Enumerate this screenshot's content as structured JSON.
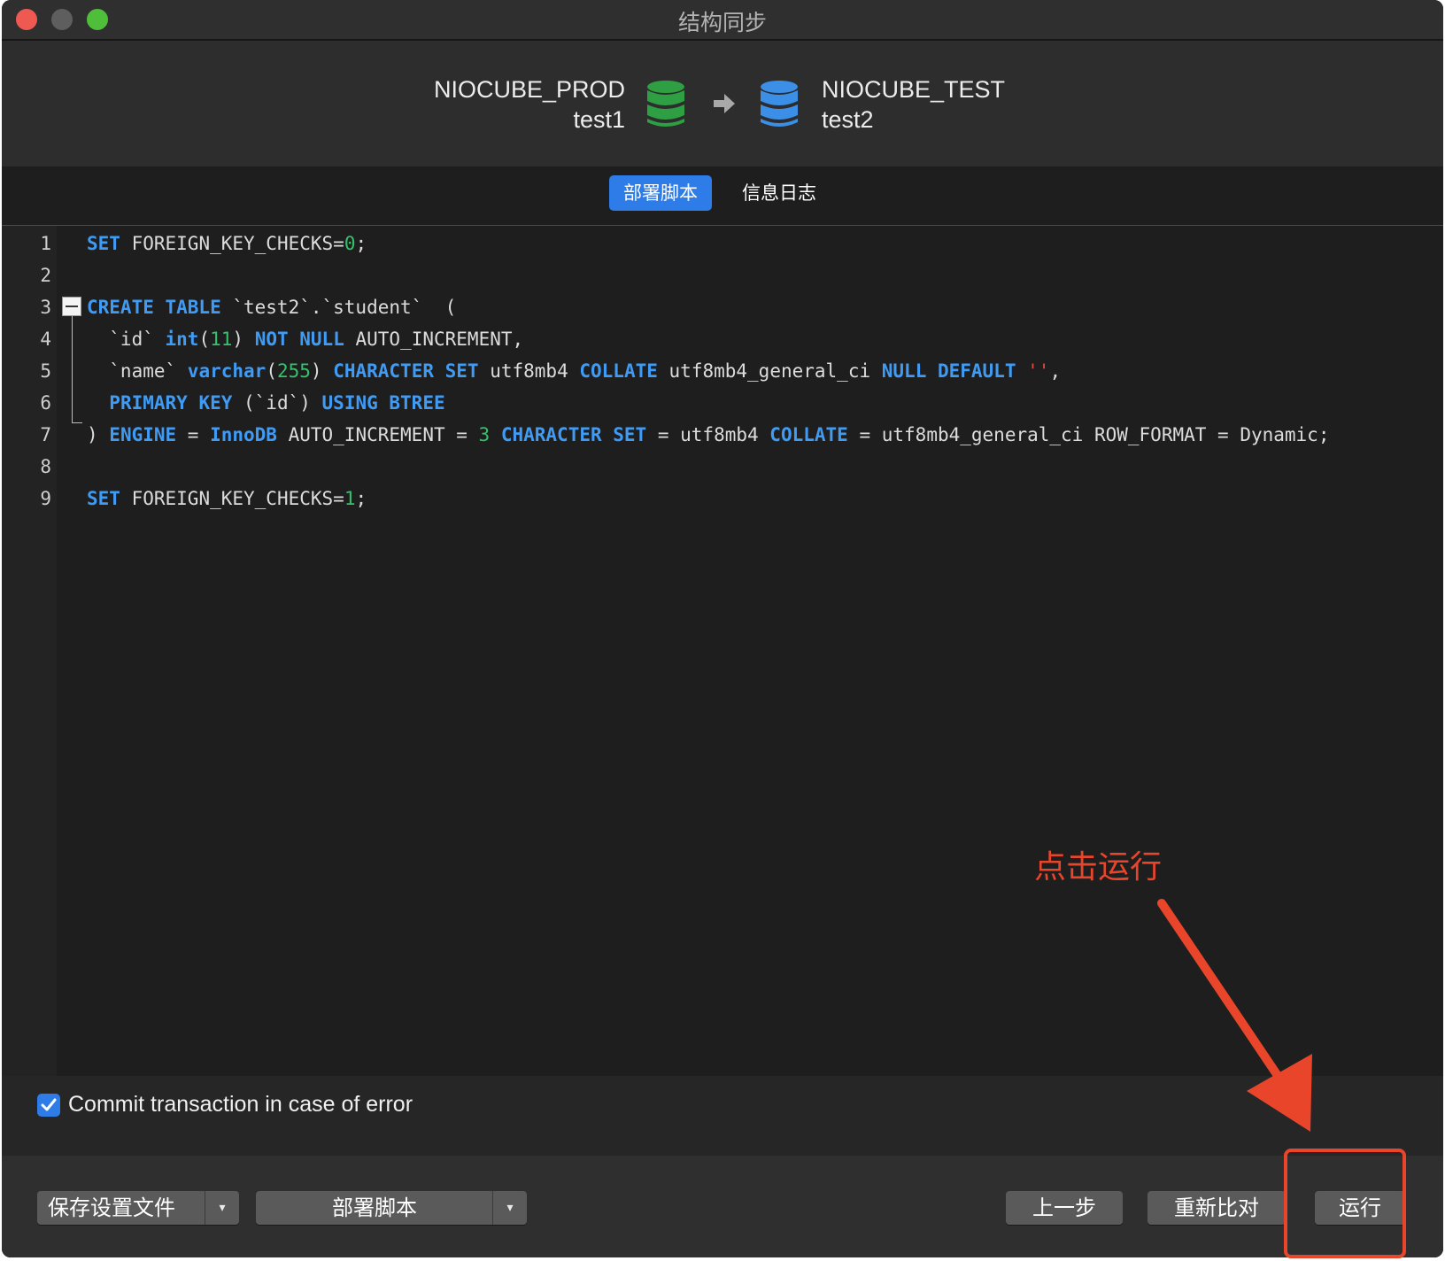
{
  "window": {
    "title": "结构同步"
  },
  "source": {
    "connection": "NIOCUBE_PROD",
    "database": "test1",
    "icon": "database-green-icon",
    "color": "#2ea043"
  },
  "target": {
    "connection": "NIOCUBE_TEST",
    "database": "test2",
    "icon": "database-blue-icon",
    "color": "#3b8fe6"
  },
  "tabs": [
    {
      "label": "部署脚本",
      "active": true
    },
    {
      "label": "信息日志",
      "active": false
    }
  ],
  "editor": {
    "line_numbers": [
      "1",
      "2",
      "3",
      "4",
      "5",
      "6",
      "7",
      "8",
      "9"
    ],
    "lines": [
      [
        {
          "t": "SET",
          "c": "kw"
        },
        {
          "t": " FOREIGN_KEY_CHECKS=",
          "c": ""
        },
        {
          "t": "0",
          "c": "num"
        },
        {
          "t": ";",
          "c": ""
        }
      ],
      [],
      [
        {
          "t": "CREATE TABLE",
          "c": "kw"
        },
        {
          "t": " `test2`.`student`  (",
          "c": ""
        }
      ],
      [
        {
          "t": "  `id` ",
          "c": ""
        },
        {
          "t": "int",
          "c": "kw"
        },
        {
          "t": "(",
          "c": ""
        },
        {
          "t": "11",
          "c": "num"
        },
        {
          "t": ") ",
          "c": ""
        },
        {
          "t": "NOT NULL",
          "c": "kw"
        },
        {
          "t": " AUTO_INCREMENT,",
          "c": ""
        }
      ],
      [
        {
          "t": "  `name` ",
          "c": ""
        },
        {
          "t": "varchar",
          "c": "kw"
        },
        {
          "t": "(",
          "c": ""
        },
        {
          "t": "255",
          "c": "num"
        },
        {
          "t": ") ",
          "c": ""
        },
        {
          "t": "CHARACTER SET",
          "c": "kw"
        },
        {
          "t": " utf8mb4 ",
          "c": ""
        },
        {
          "t": "COLLATE",
          "c": "kw"
        },
        {
          "t": " utf8mb4_general_ci ",
          "c": ""
        },
        {
          "t": "NULL DEFAULT",
          "c": "kw"
        },
        {
          "t": " ",
          "c": ""
        },
        {
          "t": "''",
          "c": "str"
        },
        {
          "t": ",",
          "c": ""
        }
      ],
      [
        {
          "t": "  ",
          "c": ""
        },
        {
          "t": "PRIMARY KEY",
          "c": "kw"
        },
        {
          "t": " (`id`) ",
          "c": ""
        },
        {
          "t": "USING BTREE",
          "c": "kw"
        }
      ],
      [
        {
          "t": ") ",
          "c": ""
        },
        {
          "t": "ENGINE",
          "c": "kw"
        },
        {
          "t": " = ",
          "c": ""
        },
        {
          "t": "InnoDB",
          "c": "kw"
        },
        {
          "t": " AUTO_INCREMENT = ",
          "c": ""
        },
        {
          "t": "3",
          "c": "num"
        },
        {
          "t": " ",
          "c": ""
        },
        {
          "t": "CHARACTER SET",
          "c": "kw"
        },
        {
          "t": " = utf8mb4 ",
          "c": ""
        },
        {
          "t": "COLLATE",
          "c": "kw"
        },
        {
          "t": " = utf8mb4_general_ci ROW_FORMAT = Dynamic;",
          "c": ""
        }
      ],
      [],
      [
        {
          "t": "SET",
          "c": "kw"
        },
        {
          "t": " FOREIGN_KEY_CHECKS=",
          "c": ""
        },
        {
          "t": "1",
          "c": "num"
        },
        {
          "t": ";",
          "c": ""
        }
      ]
    ]
  },
  "commit": {
    "label": "Commit transaction in case of error",
    "checked": true
  },
  "footer": {
    "save_label": "保存设置文件",
    "deploy_label": "部署脚本",
    "prev_label": "上一步",
    "recompare_label": "重新比对",
    "run_label": "运行",
    "caret": "▾"
  },
  "annotation": {
    "text": "点击运行",
    "color": "#e8452b"
  }
}
